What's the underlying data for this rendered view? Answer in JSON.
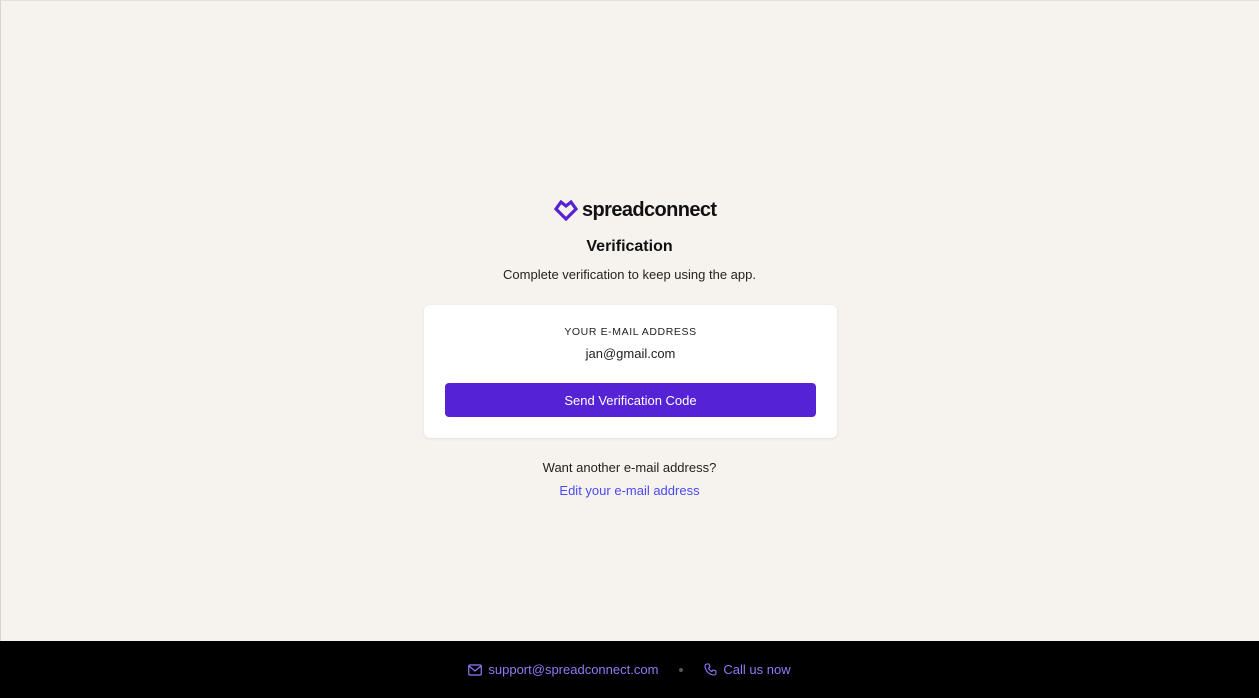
{
  "brand": {
    "name": "spreadconnect",
    "icon": "heart-diamond-icon",
    "accent_color": "#5622d6"
  },
  "verification": {
    "title": "Verification",
    "subtitle": "Complete verification to keep using the app."
  },
  "card": {
    "email_label": "YOUR E-MAIL ADDRESS",
    "email_value": "jan@gmail.com",
    "send_button_label": "Send Verification Code"
  },
  "alternate": {
    "question": "Want another e-mail address?",
    "edit_link_label": "Edit your e-mail address",
    "link_color": "#4a4af0"
  },
  "footer": {
    "email_icon": "mail-icon",
    "support_email": "support@spreadconnect.com",
    "phone_icon": "phone-icon",
    "call_label": "Call us now",
    "link_color": "#8c7cf5"
  }
}
